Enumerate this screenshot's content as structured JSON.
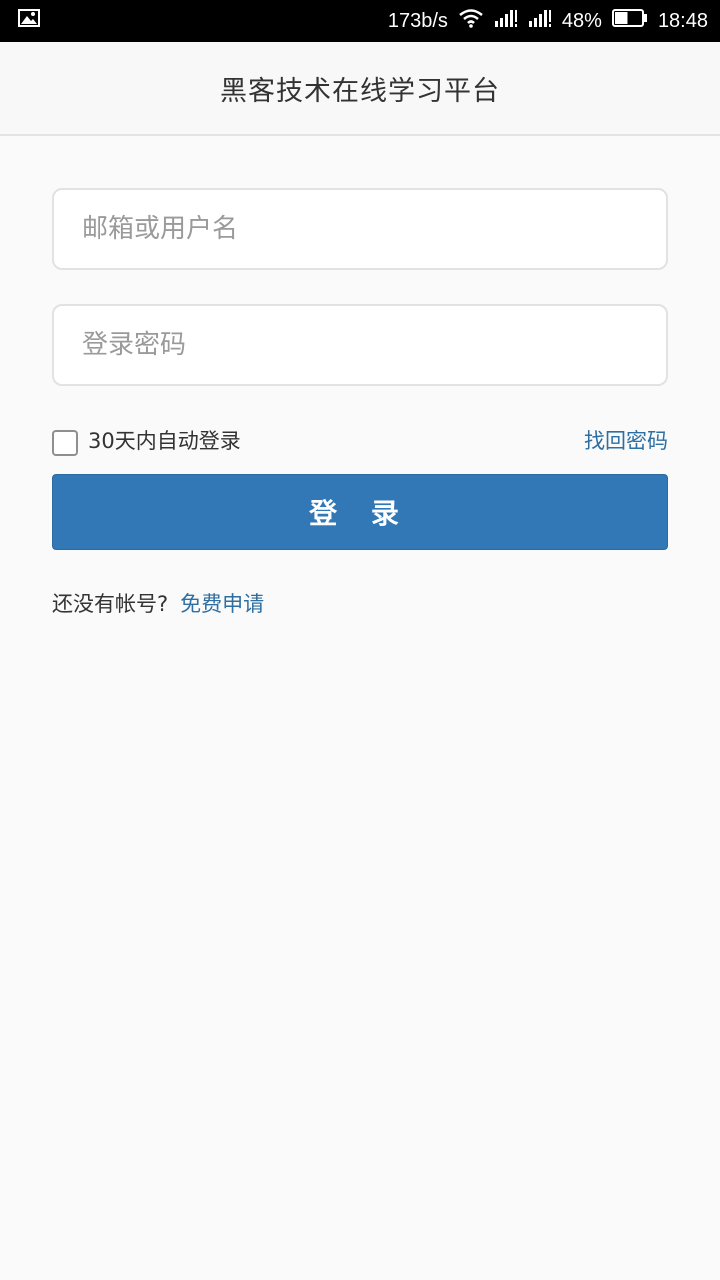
{
  "status_bar": {
    "left_icon": "image-icon",
    "network_speed": "173b/s",
    "wifi_icon": "wifi-icon",
    "signal_1_icon": "signal-icon",
    "signal_2_icon": "signal-icon",
    "battery_percent": "48%",
    "battery_level": 0.48,
    "time": "18:48"
  },
  "header": {
    "title": "黑客技术在线学习平台"
  },
  "login": {
    "username_placeholder": "邮箱或用户名",
    "username_value": "",
    "password_placeholder": "登录密码",
    "password_value": "",
    "remember_label": "30天内自动登录",
    "remember_checked": false,
    "forgot_label": "找回密码",
    "submit_label": "登 录",
    "signup_prompt": "还没有帐号?",
    "signup_link": "免费申请"
  },
  "colors": {
    "primary": "#3278b6",
    "link": "#2e6fa3",
    "background": "#fafafa",
    "status_bar": "#000000"
  }
}
